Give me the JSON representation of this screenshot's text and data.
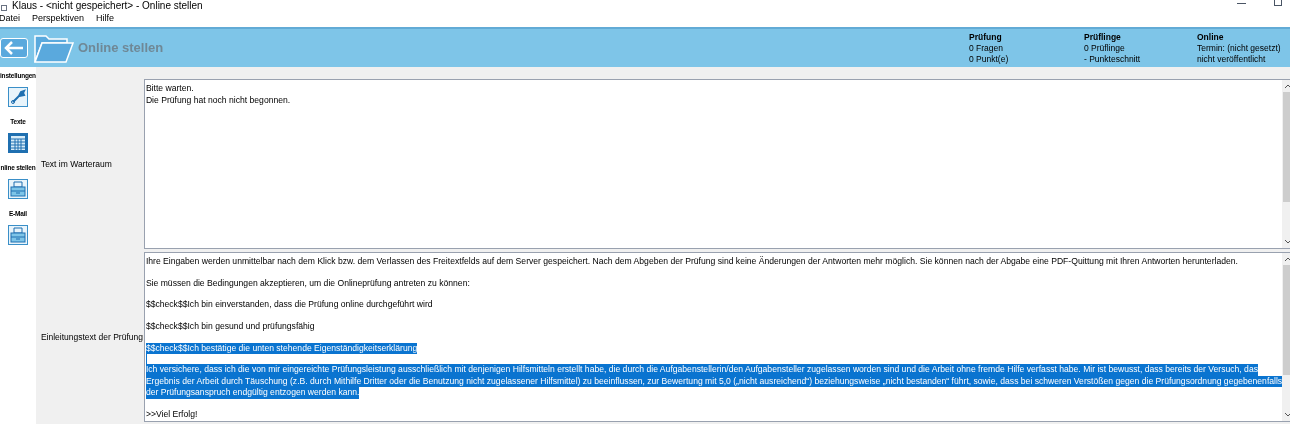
{
  "window": {
    "title": "Klaus - <nicht gespeichert> - Online stellen"
  },
  "menu": [
    "Datei",
    "Perspektiven",
    "Hilfe"
  ],
  "header": {
    "title": "Online stellen",
    "info": [
      {
        "heading": "Prüfung",
        "lines": [
          "0 Fragen",
          "0 Punkt(e)"
        ]
      },
      {
        "heading": "Prüflinge",
        "lines": [
          "0 Prüflinge",
          "- Punkteschnitt"
        ]
      },
      {
        "heading": "Online",
        "lines": [
          "Termin: (nicht gesetzt)",
          "nicht veröffentlicht"
        ]
      }
    ]
  },
  "sidebar": [
    {
      "label": "instellungen",
      "kind": "wrench"
    },
    {
      "label": "Texte",
      "kind": "grid"
    },
    {
      "label": "nline stellen",
      "kind": "cabinet"
    },
    {
      "label": "E-Mail",
      "kind": "cabinet"
    }
  ],
  "fields": [
    {
      "label": "Text im Warteraum",
      "paragraphs": [
        {
          "lines": [
            "Bitte warten.",
            "Die Prüfung hat noch nicht begonnen."
          ],
          "selected": false
        }
      ]
    },
    {
      "label": "Einleitungstext der Prüfung",
      "paragraphs": [
        {
          "lines": [
            "Ihre Eingaben werden unmittelbar nach dem Klick bzw. dem Verlassen des Freitextfelds auf dem Server gespeichert. Nach dem Abgeben der Prüfung sind keine Änderungen der Antworten mehr möglich. Sie können nach der Abgabe eine PDF-Quittung mit Ihren Antworten herunterladen."
          ],
          "selected": false
        },
        {
          "lines": [
            "Sie müssen die Bedingungen akzeptieren, um die Onlineprüfung antreten zu können:"
          ],
          "selected": false
        },
        {
          "lines": [
            "$$check$$Ich bin einverstanden, dass die Prüfung online durchgeführt wird"
          ],
          "selected": false
        },
        {
          "lines": [
            "$$check$$Ich bin gesund und prüfungsfähig"
          ],
          "selected": false
        },
        {
          "lines": [
            "$$check$$Ich bestätige die unten stehende Eigenständigkeitserklärung"
          ],
          "selected": true
        },
        {
          "lines": [
            "Ich versichere, dass ich die von mir eingereichte Prüfungsleistung ausschließlich mit denjenigen Hilfsmitteln erstellt habe, die durch die Aufgabenstellerin/den Aufgabensteller zugelassen worden sind und die Arbeit ohne fremde Hilfe verfasst habe. Mir ist bewusst, dass bereits der Versuch, das",
            "Ergebnis der Arbeit durch Täuschung (z.B. durch Mithilfe Dritter oder die Benutzung nicht zugelassener Hilfsmittel) zu beeinflussen, zur Bewertung mit 5,0 („nicht ausreichend“) beziehungsweise „nicht bestanden“ führt, sowie, dass bei schweren Verstößen gegen die Prüfungsordnung gegebenenfalls",
            "der Prüfungsanspruch endgültig entzogen werden kann."
          ],
          "selected": true
        },
        {
          "lines": [
            ">>Viel Erfolg!"
          ],
          "selected": false
        }
      ]
    }
  ]
}
